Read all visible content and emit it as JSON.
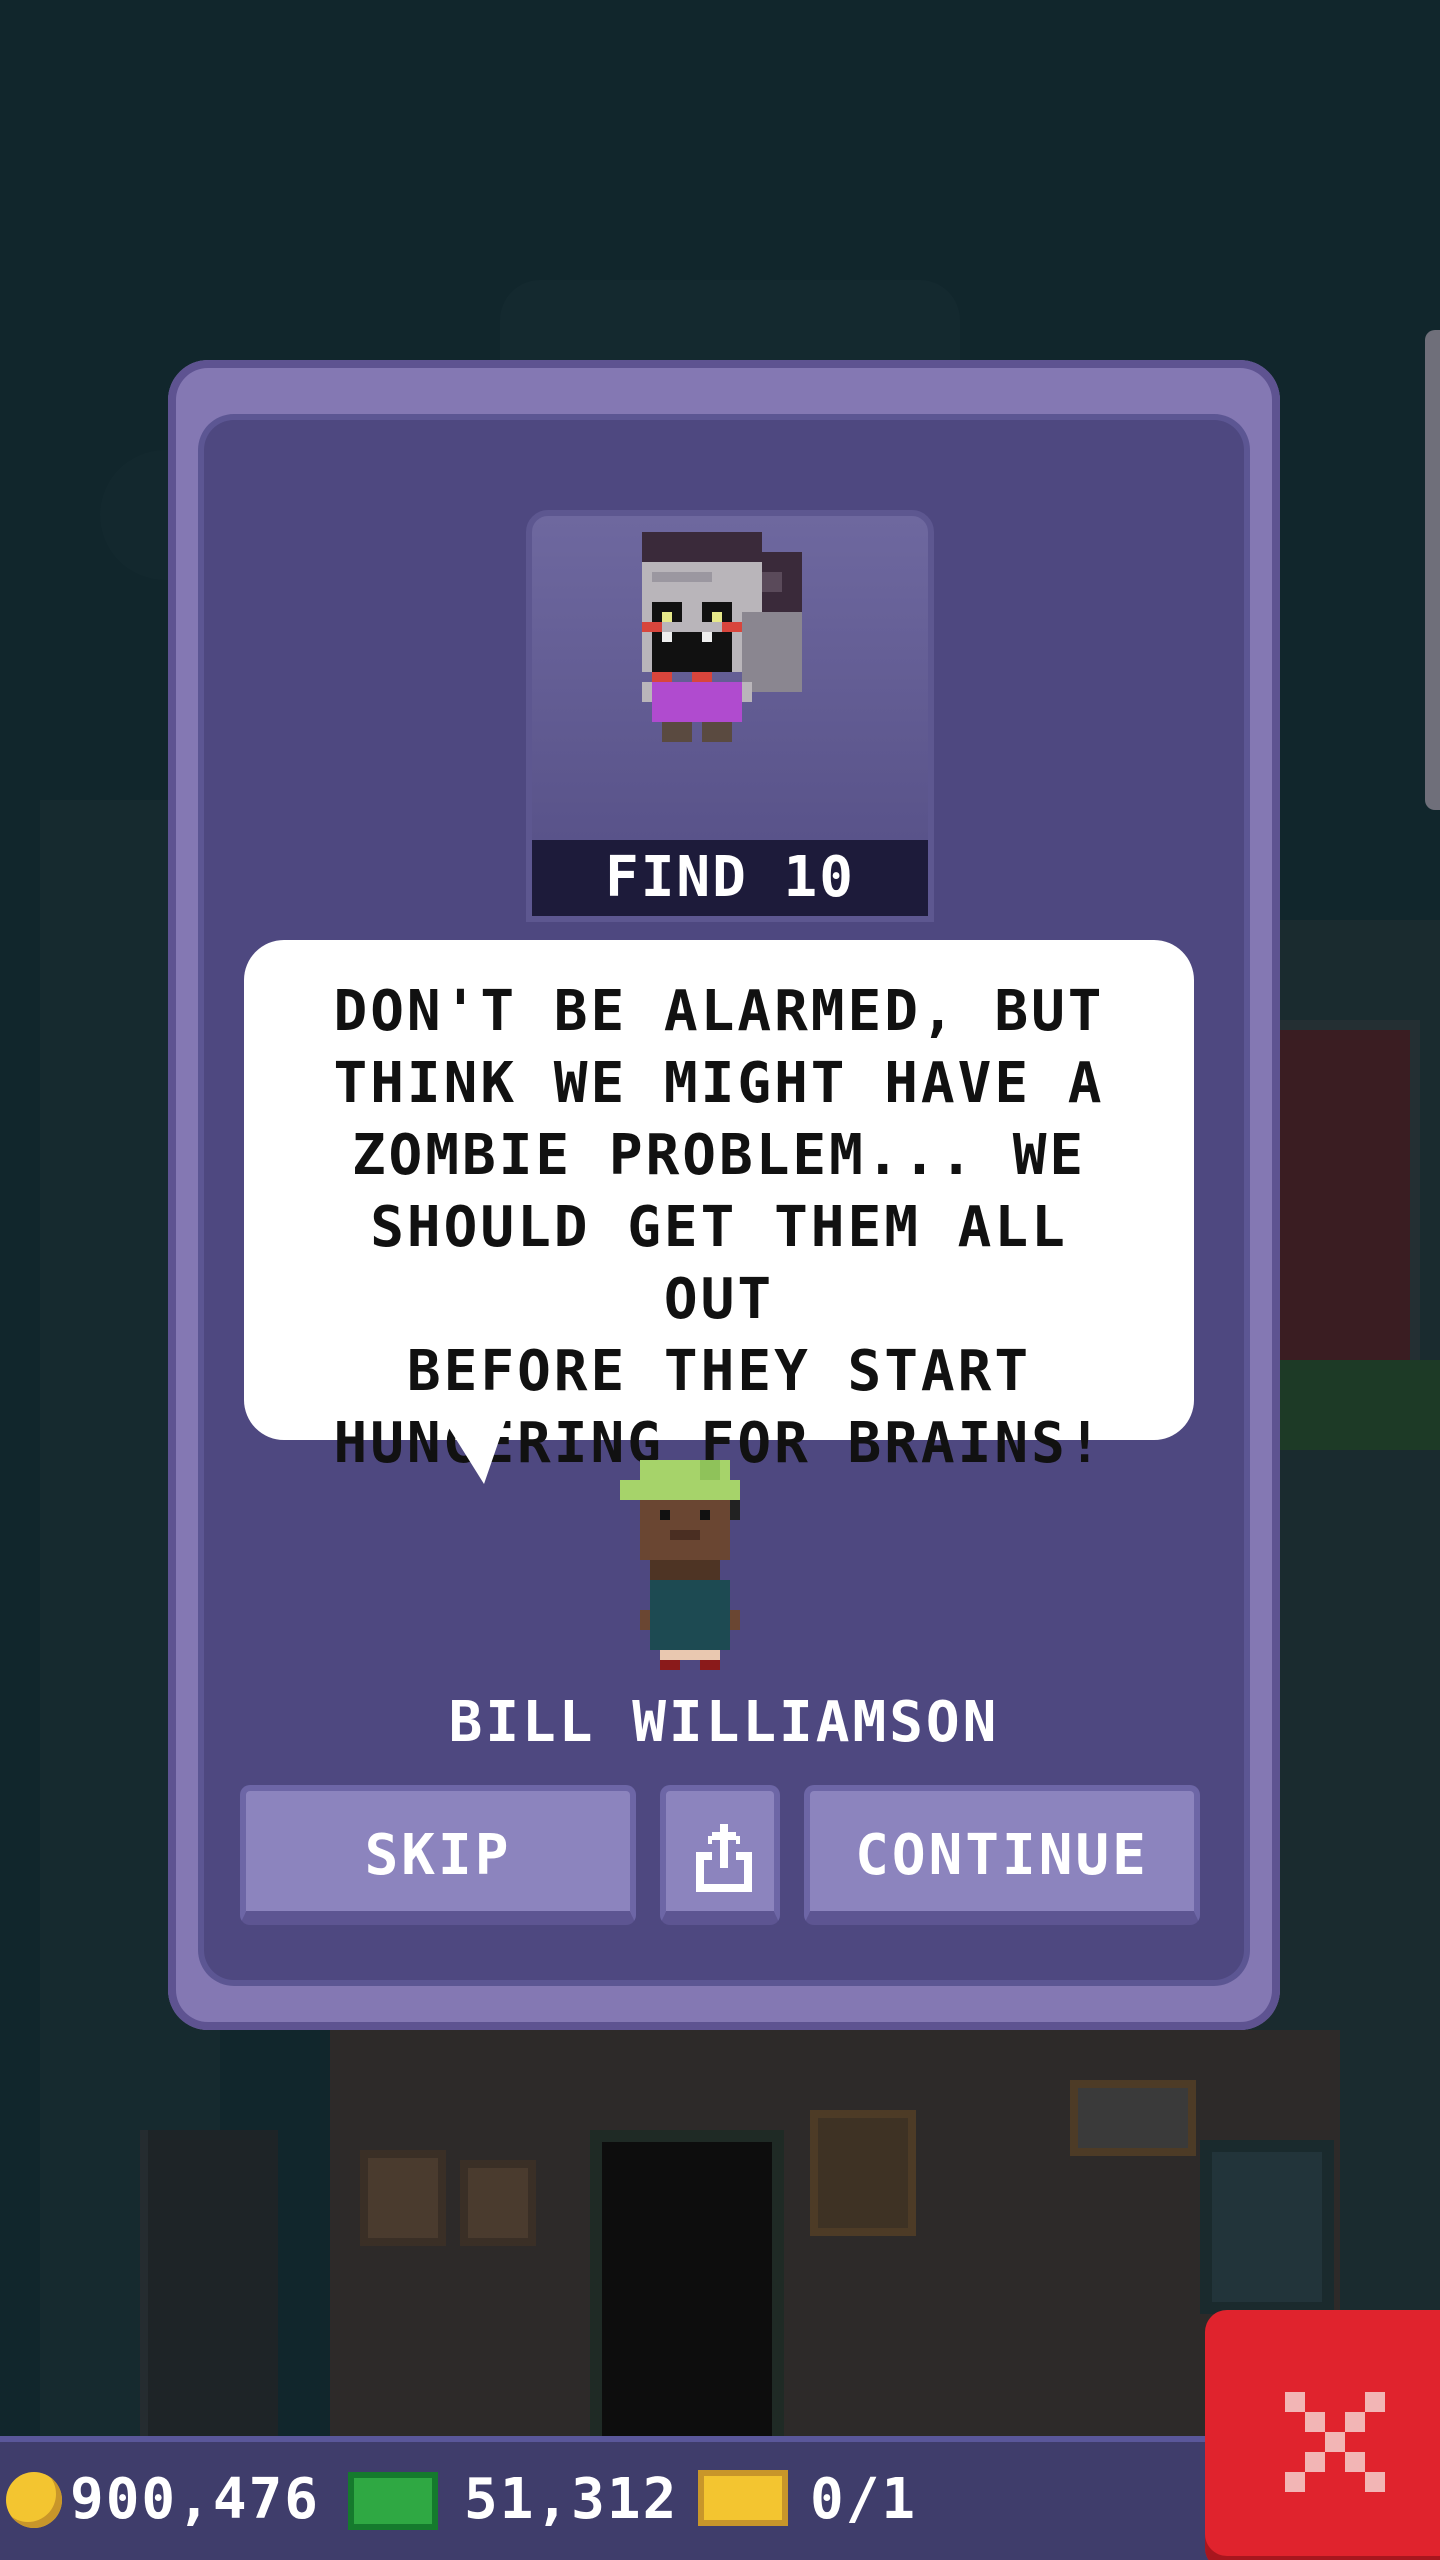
{
  "quest": {
    "goal_label": "FIND 10",
    "dialog_text": "DON'T BE ALARMED, BUT\nTHINK WE MIGHT HAVE A\nZOMBIE PROBLEM... WE\nSHOULD GET THEM ALL OUT\nBEFORE THEY START\nHUNGERING FOR BRAINS!",
    "speaker_name": "BILL WILLIAMSON",
    "target_icon": "zombie-sprite",
    "speaker_icon": "bitizen-sprite"
  },
  "buttons": {
    "skip_label": "SKIP",
    "share_icon": "share-icon",
    "continue_label": "CONTINUE",
    "close_icon": "close-icon"
  },
  "hud": {
    "coins": "900,476",
    "bux": "51,312",
    "tickets": "0/1"
  },
  "colors": {
    "dialog_bg": "#4e4880",
    "dialog_frame": "#8478b3",
    "button_bg": "#8c84be",
    "hud_bg": "#3f3d6b",
    "close_red": "#e0232d"
  }
}
